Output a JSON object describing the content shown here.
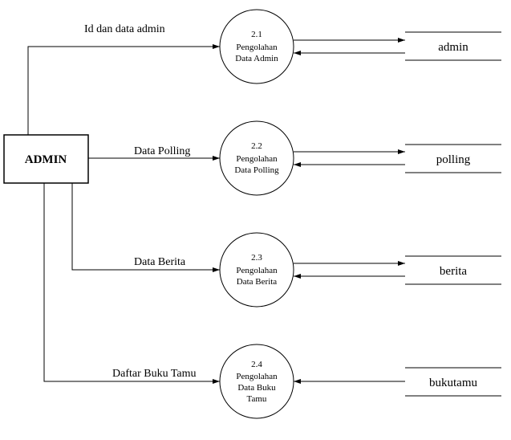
{
  "entity": {
    "label": "ADMIN"
  },
  "flows": {
    "1": "Id dan data admin",
    "2": "Data Polling",
    "3": "Data Berita",
    "4": "Daftar Buku Tamu"
  },
  "processes": {
    "1": {
      "num": "2.1",
      "line1": "Pengolahan",
      "line2": "Data Admin"
    },
    "2": {
      "num": "2.2",
      "line1": "Pengolahan",
      "line2": "Data Polling"
    },
    "3": {
      "num": "2.3",
      "line1": "Pengolahan",
      "line2": "Data Berita"
    },
    "4": {
      "num": "2.4",
      "line1": "Pengolahan",
      "line2": "Data Buku",
      "line3": "Tamu"
    }
  },
  "stores": {
    "1": "admin",
    "2": "polling",
    "3": "berita",
    "4": "bukutamu"
  }
}
